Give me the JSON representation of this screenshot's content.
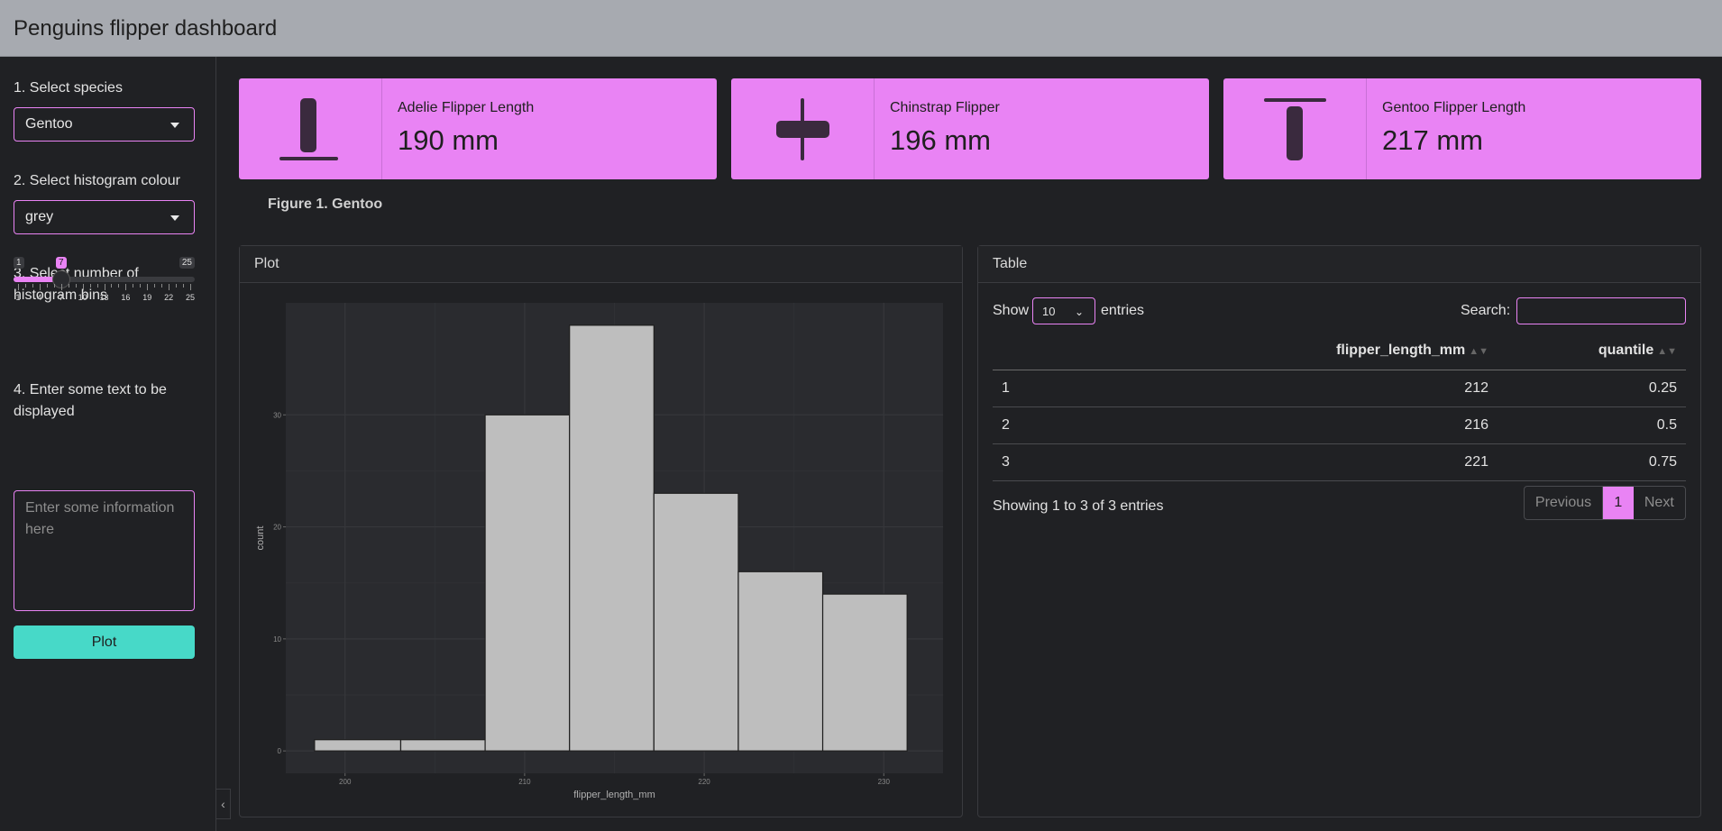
{
  "header": {
    "title": "Penguins flipper dashboard"
  },
  "sidebar": {
    "species_label": "1. Select species",
    "species_value": "Gentoo",
    "colour_label": "2. Select histogram colour",
    "colour_value": "grey",
    "bins_label": "3. Select number of histogram bins",
    "bins": {
      "min": 1,
      "max": 25,
      "value": 7,
      "min_label": "1",
      "max_label": "25",
      "value_label": "7",
      "tick_labels": [
        "1",
        "4",
        "7",
        "10",
        "13",
        "16",
        "19",
        "22",
        "25"
      ]
    },
    "text_label": "4. Enter some text to be displayed",
    "text_placeholder": "Enter some information here",
    "plot_button": "Plot"
  },
  "value_boxes": [
    {
      "title": "Adelie Flipper Length",
      "value": "190 mm",
      "icon": "flipper-low-icon"
    },
    {
      "title": "Chinstrap Flipper",
      "value": "196 mm",
      "icon": "flipper-mid-icon"
    },
    {
      "title": "Gentoo Flipper Length",
      "value": "217 mm",
      "icon": "flipper-high-icon"
    }
  ],
  "figure_caption": "Figure 1. Gentoo",
  "plot_card": {
    "title": "Plot"
  },
  "table_card": {
    "title": "Table",
    "show_label": "Show",
    "length_value": "10",
    "entries_label": "entries",
    "search_label": "Search:",
    "columns": [
      "",
      "flipper_length_mm",
      "quantile"
    ],
    "rows": [
      [
        "1",
        "212",
        "0.25"
      ],
      [
        "2",
        "216",
        "0.5"
      ],
      [
        "3",
        "221",
        "0.75"
      ]
    ],
    "info": "Showing 1 to 3 of 3 entries",
    "pager": {
      "prev": "Previous",
      "current": "1",
      "next": "Next"
    }
  },
  "colors": {
    "accent": "#e983f4",
    "button": "#47d9c8",
    "bar_fill": "#bebebe",
    "panel_bg": "#2a2b2f"
  },
  "chart_data": {
    "type": "bar",
    "xlabel": "flipper_length_mm",
    "ylabel": "count",
    "xlim": [
      196.7,
      233.3
    ],
    "ylim": [
      -2,
      40
    ],
    "x_ticks": [
      200,
      210,
      220,
      230
    ],
    "x_tick_labels": [
      "200",
      "210",
      "220",
      "230"
    ],
    "y_ticks": [
      0,
      10,
      20,
      30
    ],
    "y_tick_labels": [
      "0",
      "10",
      "20",
      "30"
    ],
    "bins": [
      {
        "start": 198.3,
        "end": 203.1,
        "count": 1
      },
      {
        "start": 203.1,
        "end": 207.8,
        "count": 1
      },
      {
        "start": 207.8,
        "end": 212.5,
        "count": 30
      },
      {
        "start": 212.5,
        "end": 217.2,
        "count": 38
      },
      {
        "start": 217.2,
        "end": 221.9,
        "count": 23
      },
      {
        "start": 221.9,
        "end": 226.6,
        "count": 16
      },
      {
        "start": 226.6,
        "end": 231.3,
        "count": 14
      }
    ]
  }
}
